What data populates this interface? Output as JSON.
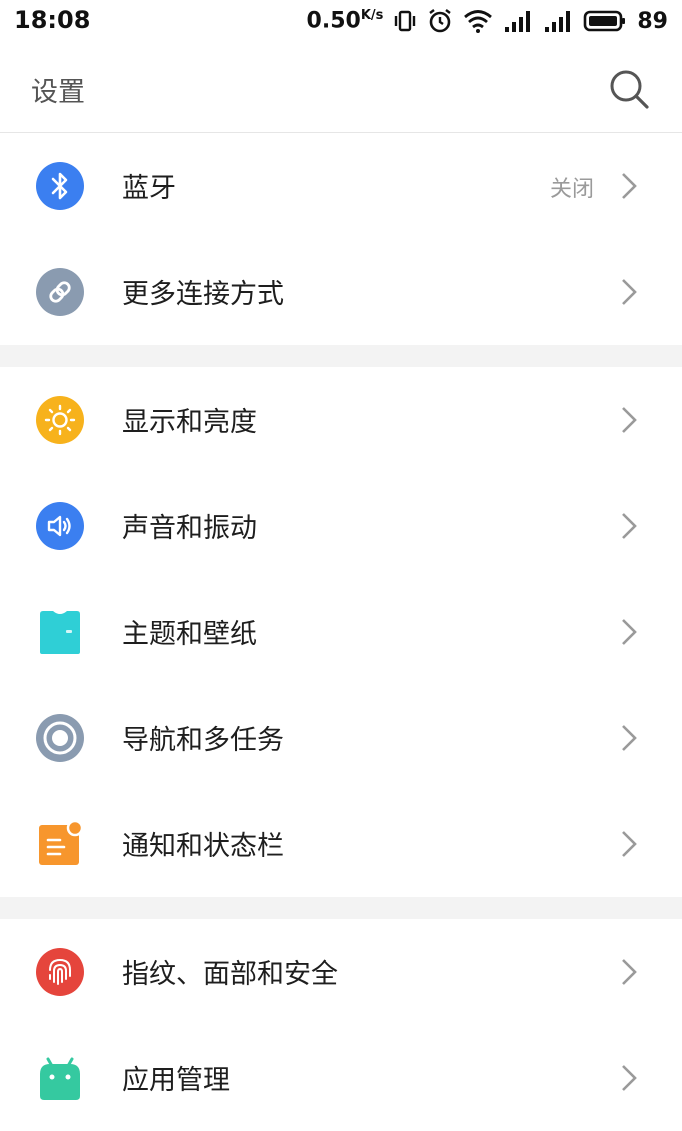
{
  "status_bar": {
    "time": "18:08",
    "speed": "0.50",
    "speed_unit": "K/s",
    "battery": "89"
  },
  "header": {
    "title": "设置",
    "search_icon": "search-icon"
  },
  "groups": [
    {
      "items": [
        {
          "label": "蓝牙",
          "value": "关闭",
          "icon": "bluetooth-icon",
          "color": "#3b7ff0"
        },
        {
          "label": "更多连接方式",
          "icon": "link-icon",
          "color": "#8a9bb0"
        }
      ]
    },
    {
      "items": [
        {
          "label": "显示和亮度",
          "icon": "brightness-icon",
          "color": "#f7b21c"
        },
        {
          "label": "声音和振动",
          "icon": "speaker-icon",
          "color": "#3b7ff0"
        },
        {
          "label": "主题和壁纸",
          "icon": "tshirt-icon",
          "color": "#2fcfd6"
        },
        {
          "label": "导航和多任务",
          "icon": "navigation-icon",
          "color": "#8a9bb0"
        },
        {
          "label": "通知和状态栏",
          "icon": "notification-icon",
          "color": "#f7962d"
        }
      ]
    },
    {
      "items": [
        {
          "label": "指纹、面部和安全",
          "icon": "fingerprint-icon",
          "color": "#e5453c"
        },
        {
          "label": "应用管理",
          "icon": "android-icon",
          "color": "#35c9a0"
        }
      ]
    }
  ]
}
